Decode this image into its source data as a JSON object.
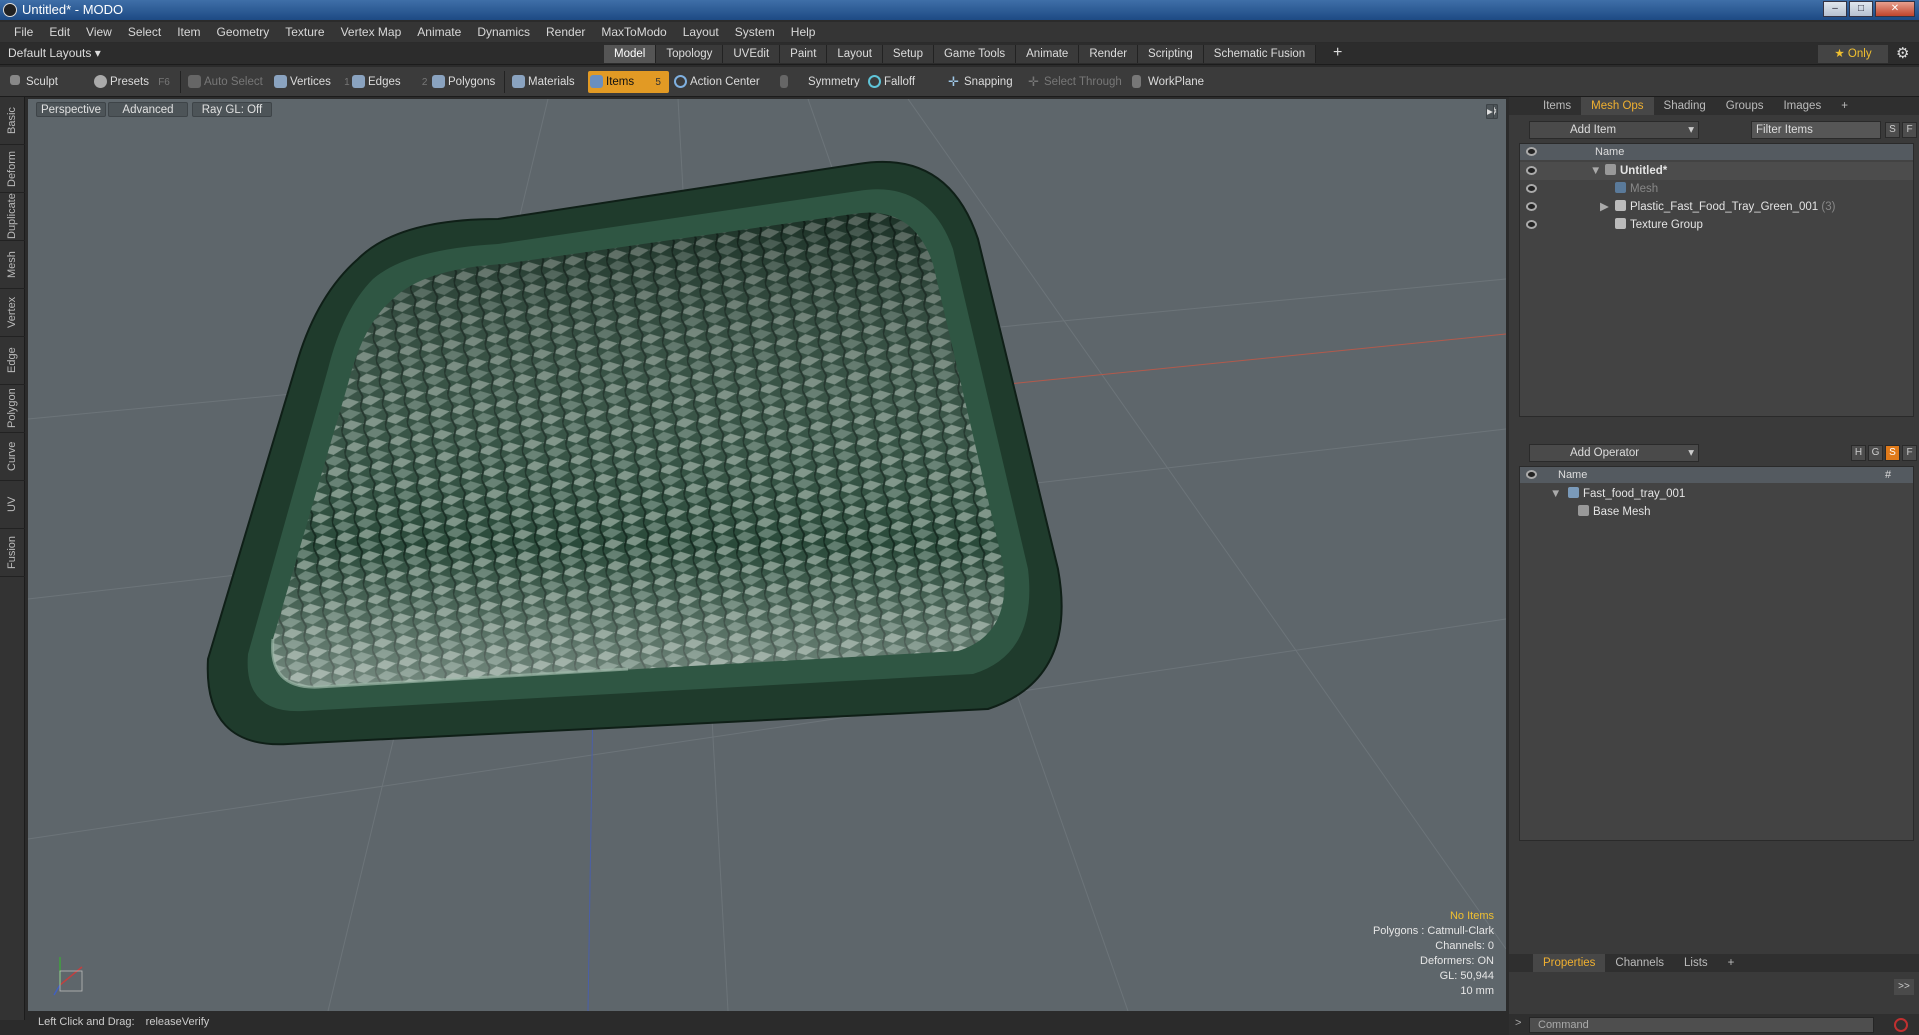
{
  "window": {
    "title": "Untitled* - MODO",
    "minimize": "–",
    "maximize": "□",
    "close": "✕"
  },
  "menu": [
    "File",
    "Edit",
    "View",
    "Select",
    "Item",
    "Geometry",
    "Texture",
    "Vertex Map",
    "Animate",
    "Dynamics",
    "Render",
    "MaxToModo",
    "Layout",
    "System",
    "Help"
  ],
  "layout": {
    "selector": "Default Layouts ▾",
    "tabs": [
      "Model",
      "Topology",
      "UVEdit",
      "Paint",
      "Layout",
      "Setup",
      "Game Tools",
      "Animate",
      "Render",
      "Scripting",
      "Schematic Fusion"
    ],
    "active_tab": "Model",
    "add_tab": "+",
    "only_label": "★ Only"
  },
  "toolbar": {
    "sculpt": "Sculpt",
    "presets": "Presets",
    "presets_key": "F6",
    "auto_select": "Auto Select",
    "vertices": "Vertices",
    "vertices_count": "1",
    "edges": "Edges",
    "edges_count": "2",
    "polygons": "Polygons",
    "materials": "Materials",
    "items": "Items",
    "items_count": "5",
    "action_center": "Action Center",
    "symmetry": "Symmetry",
    "falloff": "Falloff",
    "snapping": "Snapping",
    "select_through": "Select Through",
    "workplane": "WorkPlane"
  },
  "left_tabs": [
    "Basic",
    "Deform",
    "Duplicate",
    "Mesh Edit",
    "Vertex",
    "Edge",
    "Polygon",
    "Curve",
    "UV",
    "Fusion"
  ],
  "viewport": {
    "view": "Perspective",
    "shading": "Advanced",
    "raygl": "Ray GL: Off",
    "stats": {
      "selection": "No Items",
      "polygons": "Polygons : Catmull-Clark",
      "channels": "Channels: 0",
      "deformers": "Deformers: ON",
      "gl": "GL: 50,944",
      "scale": "10 mm"
    },
    "colors": {
      "background": "#5e666b",
      "tray": "#1f3b2c",
      "tray_rim": "#2f5643"
    }
  },
  "status": {
    "hint": "Left Click and Drag:",
    "action": "releaseVerify"
  },
  "items_panel": {
    "tabs": [
      "Items",
      "Mesh Ops",
      "Shading",
      "Groups",
      "Images",
      "+"
    ],
    "active_tab": "Mesh Ops",
    "add_item": "Add Item",
    "filter": "Filter Items",
    "s_btn": "S",
    "f_btn": "F",
    "name_header": "Name",
    "rows": [
      {
        "name": "Untitled*",
        "icon": "scene-icon"
      },
      {
        "name": "Mesh",
        "icon": "mesh-icon"
      },
      {
        "name": "Plastic_Fast_Food_Tray_Green_001",
        "count": "(3)",
        "icon": "locator-icon"
      },
      {
        "name": "Texture Group",
        "icon": "group-icon"
      }
    ]
  },
  "meshops_panel": {
    "add_operator": "Add Operator",
    "h_btn": "H",
    "g_btn": "G",
    "s_btn": "S",
    "f_btn": "F",
    "name_header": "Name",
    "hash_header": "#",
    "rows": [
      {
        "name": "Fast_food_tray_001",
        "icon": "mesh-icon"
      },
      {
        "name": "Base Mesh",
        "icon": "base-mesh-icon"
      }
    ]
  },
  "properties_panel": {
    "tabs": [
      "Properties",
      "Channels",
      "Lists",
      "+"
    ],
    "active_tab": "Properties",
    "expand": ">>"
  },
  "command": {
    "prompt": ">",
    "placeholder": "Command"
  }
}
